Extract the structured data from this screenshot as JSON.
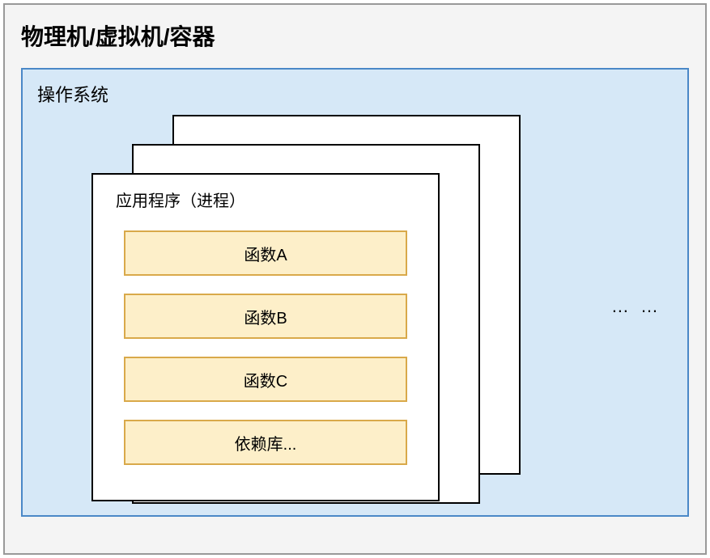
{
  "outer": {
    "title": "物理机/虚拟机/容器"
  },
  "os": {
    "title": "操作系统"
  },
  "app": {
    "title": "应用程序（进程）",
    "items": [
      "函数A",
      "函数B",
      "函数C",
      "依赖库..."
    ]
  },
  "ellipsis": "… …"
}
